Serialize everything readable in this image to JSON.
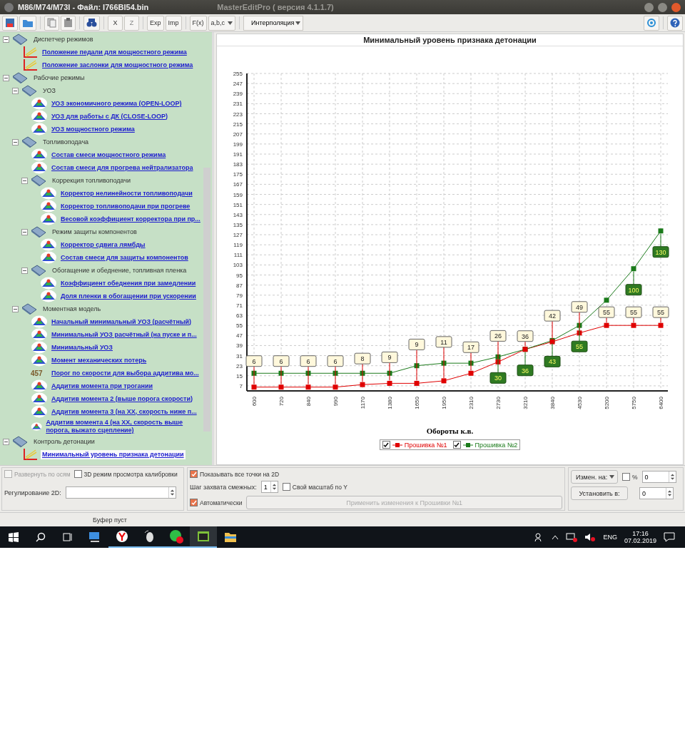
{
  "window": {
    "title": "M86/M74/M73I - Файл: I766BI54.bin",
    "app_title": "MasterEditPro ( версия 4.1.1.7)"
  },
  "toolbar": {
    "buttons": [
      {
        "kind": "save"
      },
      {
        "kind": "open"
      },
      {
        "kind": "copy"
      },
      {
        "kind": "paste"
      },
      {
        "kind": "find"
      },
      {
        "kind": "text",
        "label": "X",
        "disabled": false
      },
      {
        "kind": "text",
        "label": "Z",
        "disabled": true
      },
      {
        "kind": "text",
        "label": "Exp",
        "disabled": false
      },
      {
        "kind": "text",
        "label": "Imp",
        "disabled": false
      },
      {
        "kind": "text",
        "label": "F(x)",
        "disabled": false
      },
      {
        "kind": "dropdown",
        "label": "a,b,c"
      }
    ],
    "mode_select": "Интерполяция"
  },
  "tree": [
    {
      "kind": "folder",
      "label": "Диспетчер режимов",
      "expanded": true,
      "children": [
        {
          "kind": "chart2d",
          "label": "Положение педали для мощностного режима",
          "selected": false
        },
        {
          "kind": "chart2d",
          "label": "Положение заслонки для мощностного режима",
          "selected": false
        }
      ]
    },
    {
      "kind": "folder",
      "label": "Рабочие режимы",
      "expanded": true,
      "children": [
        {
          "kind": "folder",
          "label": "УОЗ",
          "expanded": true,
          "children": [
            {
              "kind": "map3d",
              "label": "УОЗ экономичного режима (OPEN-LOOP)",
              "selected": false
            },
            {
              "kind": "map3d",
              "label": "УОЗ для работы с ДК (CLOSE-LOOP)",
              "selected": false
            },
            {
              "kind": "map3d",
              "label": "УОЗ мощностного режима",
              "selected": false
            }
          ]
        },
        {
          "kind": "folder",
          "label": "Топливоподача",
          "expanded": true,
          "children": [
            {
              "kind": "map3d",
              "label": "Состав смеси мощностного режима",
              "selected": false
            },
            {
              "kind": "map3d",
              "label": "Состав смеси для прогрева нейтрализатора",
              "selected": false
            },
            {
              "kind": "folder",
              "label": "Коррекция топливоподачи",
              "expanded": true,
              "children": [
                {
                  "kind": "map3d",
                  "label": "Корректор нелинейности топливоподачи",
                  "selected": false
                },
                {
                  "kind": "map3d",
                  "label": "Корректор топливоподачи при прогреве",
                  "selected": false
                },
                {
                  "kind": "map3d",
                  "label": "Весовой коэффициент корректора при пр...",
                  "selected": false
                }
              ]
            },
            {
              "kind": "folder",
              "label": "Режим защиты компонентов",
              "expanded": true,
              "children": [
                {
                  "kind": "map3d",
                  "label": "Корректор сдвига лямбды",
                  "selected": false
                },
                {
                  "kind": "map3d",
                  "label": "Состав смеси для защиты компонентов",
                  "selected": false
                }
              ]
            },
            {
              "kind": "folder",
              "label": "Обогащение и обеднение, топливная пленка",
              "expanded": true,
              "children": [
                {
                  "kind": "map3d",
                  "label": "Коэффициент обеднения при замедлении",
                  "selected": false
                },
                {
                  "kind": "map3d",
                  "label": "Доля пленки в обогащении при ускорении",
                  "selected": false
                }
              ]
            }
          ]
        },
        {
          "kind": "folder",
          "label": "Моментная модель",
          "expanded": true,
          "children": [
            {
              "kind": "map3d",
              "label": "Начальный минимальный УОЗ (расчётный)",
              "selected": false
            },
            {
              "kind": "map3d",
              "label": "Минимальный УОЗ расчётный (на пуске и п...",
              "selected": false
            },
            {
              "kind": "map3d",
              "label": "Минимальный УОЗ",
              "selected": false
            },
            {
              "kind": "map3d",
              "label": "Момент механических потерь",
              "selected": false
            },
            {
              "kind": "number",
              "icon_text": "457",
              "label": "Порог по скорости для выбора аддитива мо...",
              "selected": false
            },
            {
              "kind": "map3d",
              "label": "Аддитив момента при трогании",
              "selected": false
            },
            {
              "kind": "map3d",
              "label": "Аддитив момента 2 (выше порога скорости)",
              "selected": false
            },
            {
              "kind": "map3d",
              "label": "Аддитив момента 3 (на ХХ, скорость ниже п...",
              "selected": false
            },
            {
              "kind": "map3d",
              "label": "Аддитив момента 4 (на ХХ, скорость выше порога, выжато сцепление)",
              "selected": false
            }
          ]
        }
      ]
    },
    {
      "kind": "folder",
      "label": "Контроль детонации",
      "expanded": true,
      "children": [
        {
          "kind": "chart2d",
          "label": "Минимальный уровень признака детонации",
          "selected": true
        }
      ]
    }
  ],
  "chart": {
    "title": "Минимальный уровень признака детонации",
    "chart_data": {
      "type": "line",
      "xlabel": "Обороты к.в.",
      "categories": [
        "600",
        "720",
        "840",
        "990",
        "1170",
        "1380",
        "1650",
        "1950",
        "2310",
        "2730",
        "3210",
        "3840",
        "4530",
        "5200",
        "5750",
        "6400"
      ],
      "ylim": [
        3,
        255
      ],
      "yticks": [
        7,
        15,
        23,
        31,
        39,
        47,
        55,
        63,
        71,
        79,
        87,
        95,
        103,
        111,
        119,
        127,
        135,
        143,
        151,
        159,
        167,
        175,
        183,
        191,
        199,
        207,
        215,
        223,
        231,
        239,
        247,
        255
      ],
      "grid": true,
      "series": [
        {
          "name": "Прошивка №1",
          "color": "#e00000",
          "marker": "square",
          "values": [
            6,
            6,
            6,
            6,
            8,
            9,
            9,
            11,
            17,
            26,
            36,
            42,
            49,
            55,
            55,
            55
          ],
          "value_labels": [
            "6",
            "6",
            "6",
            "6",
            "8",
            "9",
            "9",
            "11",
            "17",
            "26",
            "36",
            "42",
            "49",
            "55",
            "55",
            "55"
          ]
        },
        {
          "name": "Прошивка №2",
          "color": "#1a7a1a",
          "marker": "square",
          "values": [
            17,
            17,
            17,
            17,
            17,
            17,
            23,
            25,
            25,
            30,
            36,
            43,
            55,
            75,
            100,
            130
          ],
          "value_labels": [
            null,
            null,
            null,
            null,
            null,
            null,
            null,
            null,
            null,
            "30",
            "36",
            "43",
            "55",
            null,
            "100",
            "130"
          ]
        }
      ]
    },
    "legend": [
      {
        "checked": true
      },
      {
        "checked": true
      }
    ]
  },
  "options": {
    "expand_axes": {
      "label": "Развернуть по осям",
      "checked": false,
      "disabled": true
    },
    "view_3d": {
      "label": "3D режим просмотра калибровки",
      "checked": false
    },
    "regulation_label": "Регулирование 2D:",
    "show_points": {
      "label": "Показывать все точки на 2D",
      "checked": true
    },
    "step_label": "Шаг захвата смежных:",
    "step_value": "1",
    "own_scale": {
      "label": "Свой масштаб по Y",
      "checked": false
    },
    "auto": {
      "label": "Автоматически",
      "checked": true
    },
    "apply_button": {
      "label": "Применить изменения к Прошивки №1",
      "disabled": true
    },
    "change_select": "Измен. на:",
    "percent": {
      "label": "%",
      "checked": false
    },
    "change_value": "0",
    "set_button": "Установить в:",
    "set_value": "0"
  },
  "status_bar": {
    "text": "Буфер пуст"
  },
  "taskbar": {
    "language": "ENG",
    "time": "17:16",
    "date": "07.02.2019"
  }
}
